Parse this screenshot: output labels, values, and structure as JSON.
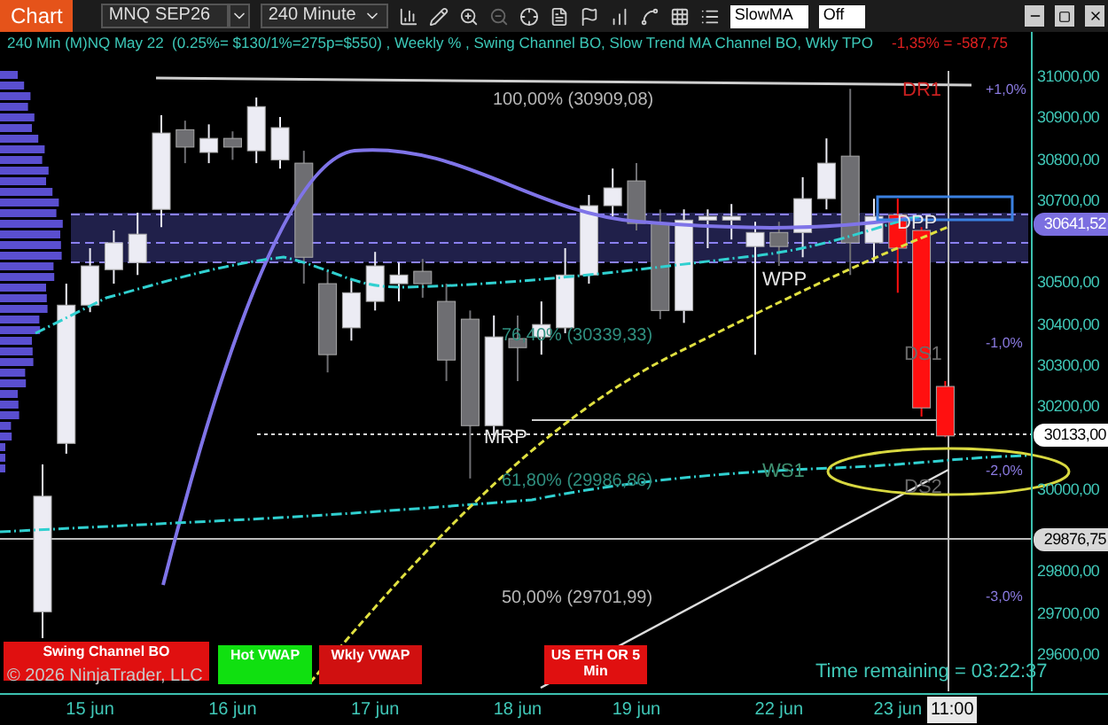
{
  "toolbar": {
    "app_button": "Chart",
    "instrument": "MNQ SEP26",
    "interval": "240 Minute",
    "inputs": [
      {
        "value": "SlowMA"
      },
      {
        "value": "Off"
      }
    ]
  },
  "chart": {
    "header": "240 Min (M)NQ May 22  (0.25%= $130/1%=275p=$550) , Weekly % , Swing Channel BO, Slow Trend MA Channel BO, Wkly TPO",
    "pnl": "-1,35% = -587,75",
    "chart_data": {
      "type": "candlestick",
      "categories": [
        null,
        null,
        "15 jun",
        null,
        null,
        null,
        null,
        null,
        "16 jun",
        null,
        null,
        null,
        null,
        null,
        "17 jun",
        null,
        null,
        null,
        null,
        null,
        "18 jun",
        null,
        null,
        null,
        null,
        "19 jun",
        null,
        null,
        null,
        null,
        null,
        "22 jun",
        null,
        null,
        null,
        null,
        "23 jun",
        null,
        null
      ],
      "ylim": [
        29510,
        31112
      ],
      "yticks": [
        {
          "value": 31000,
          "label": "31000,00"
        },
        {
          "value": 30900,
          "label": "30900,00"
        },
        {
          "value": 30800,
          "label": "30800,00"
        },
        {
          "value": 30700,
          "label": "30700,00"
        },
        {
          "value": 30500,
          "label": "30500,00"
        },
        {
          "value": 30400,
          "label": "30400,00"
        },
        {
          "value": 30300,
          "label": "30300,00"
        },
        {
          "value": 30200,
          "label": "30200,00"
        },
        {
          "value": 30000,
          "label": "30000,00"
        },
        {
          "value": 29800,
          "label": "29800,00"
        },
        {
          "value": 29700,
          "label": "29700,00"
        },
        {
          "value": 29600,
          "label": "29600,00"
        }
      ],
      "series": [
        {
          "color": "#ececf4",
          "ohlc": [
            [
              29707,
              30064,
              29643,
              29987
            ],
            [
              30115,
              30502,
              30090,
              30450
            ],
            [
              30450,
              30588,
              30433,
              30545
            ],
            [
              30536,
              30631,
              30502,
              30601
            ],
            [
              30553,
              30674,
              30523,
              30622
            ],
            [
              30682,
              30910,
              30639,
              30867
            ],
            null,
            [
              30820,
              30888,
              30794,
              30854
            ],
            null,
            [
              30824,
              30953,
              30794,
              30931
            ],
            [
              30802,
              30906,
              30781,
              30880
            ],
            null,
            null,
            [
              30395,
              30510,
              30364,
              30480
            ],
            [
              30459,
              30579,
              30437,
              30545
            ],
            [
              30502,
              30553,
              30459,
              30523
            ],
            null,
            null,
            null,
            [
              30158,
              30425,
              30124,
              30373
            ],
            null,
            [
              30373,
              30459,
              30330,
              30403
            ],
            [
              30395,
              30588,
              30382,
              30523
            ],
            [
              30523,
              30717,
              30502,
              30691
            ],
            [
              30691,
              30781,
              30665,
              30734
            ],
            null,
            null,
            [
              30437,
              30682,
              30407,
              30656
            ],
            [
              30656,
              30682,
              30588,
              30665
            ],
            [
              30656,
              30695,
              30609,
              30665
            ],
            [
              30592,
              30652,
              30330,
              30626
            ],
            null,
            [
              30626,
              30760,
              30566,
              30708
            ],
            [
              30708,
              30854,
              30682,
              30794
            ],
            null,
            [
              30601,
              30708,
              30553,
              30665
            ],
            null,
            null,
            null
          ]
        },
        {
          "color": "#6e6e72",
          "ohlc": [
            null,
            null,
            null,
            null,
            null,
            null,
            [
              30875,
              30897,
              30794,
              30833
            ],
            null,
            [
              30854,
              30871,
              30802,
              30833
            ],
            null,
            null,
            [
              30794,
              30824,
              30502,
              30566
            ],
            [
              30502,
              30536,
              30287,
              30330
            ],
            null,
            null,
            null,
            [
              30532,
              30562,
              30468,
              30502
            ],
            [
              30459,
              30502,
              30266,
              30317
            ],
            [
              30416,
              30437,
              30030,
              30158
            ],
            null,
            [
              30369,
              30425,
              30266,
              30347
            ],
            null,
            null,
            null,
            null,
            [
              30751,
              30794,
              30631,
              30648
            ],
            [
              30648,
              30682,
              30416,
              30437
            ],
            null,
            null,
            null,
            null,
            [
              30626,
              30652,
              30545,
              30592
            ],
            null,
            null,
            [
              30811,
              30974,
              30523,
              30601
            ],
            null,
            null,
            null,
            null
          ]
        },
        {
          "color": "#ff1010",
          "ohlc": [
            null,
            null,
            null,
            null,
            null,
            null,
            null,
            null,
            null,
            null,
            null,
            null,
            null,
            null,
            null,
            null,
            null,
            null,
            null,
            null,
            null,
            null,
            null,
            null,
            null,
            null,
            null,
            null,
            null,
            null,
            null,
            null,
            null,
            null,
            null,
            null,
            [
              30669,
              30708,
              30480,
              30588
            ],
            [
              30631,
              30639,
              30180,
              30201
            ],
            [
              30253,
              30266,
              30130,
              30133
            ]
          ]
        }
      ]
    },
    "labels": [
      {
        "text": "DR1",
        "kind": "resistance"
      },
      {
        "text": "+1,0%",
        "kind": "percent"
      },
      {
        "text": "100,00% (30909,08)",
        "kind": "fib"
      },
      {
        "text": "DPP",
        "kind": "pivot"
      },
      {
        "text": "WPP",
        "kind": "pivot"
      },
      {
        "text": "76,40% (30339,33)",
        "kind": "fib-level"
      },
      {
        "text": "-1,0%",
        "kind": "percent"
      },
      {
        "text": "DS1",
        "kind": "support"
      },
      {
        "text": "MRP",
        "kind": "pivot"
      },
      {
        "text": "WS1",
        "kind": "weekly-support"
      },
      {
        "text": "-2,0%",
        "kind": "percent"
      },
      {
        "text": "61,80% (29986,86)",
        "kind": "fib-level"
      },
      {
        "text": "DS2",
        "kind": "support"
      },
      {
        "text": "50,00% (29701,99)",
        "kind": "fib"
      },
      {
        "text": "-3,0%",
        "kind": "percent"
      }
    ],
    "signals": [
      {
        "text": "Swing Channel BO",
        "color": "#e01010"
      },
      {
        "text": "Hot VWAP",
        "color": "#10e010"
      },
      {
        "text": "Wkly VWAP",
        "color": "#d01010"
      },
      {
        "text": "US ETH OR 5 Min",
        "color": "#e01010"
      }
    ],
    "copyright": "© 2026 NinjaTrader, LLC",
    "time_remaining": "Time remaining = 03:22:37"
  },
  "price_axis": {
    "tags": [
      {
        "text": "30641,52",
        "kind": "last"
      },
      {
        "text": "30133,00",
        "kind": "level"
      },
      {
        "text": "29876,75",
        "kind": "cursor"
      }
    ]
  },
  "time_axis": {
    "cursor_time": "11:00"
  }
}
